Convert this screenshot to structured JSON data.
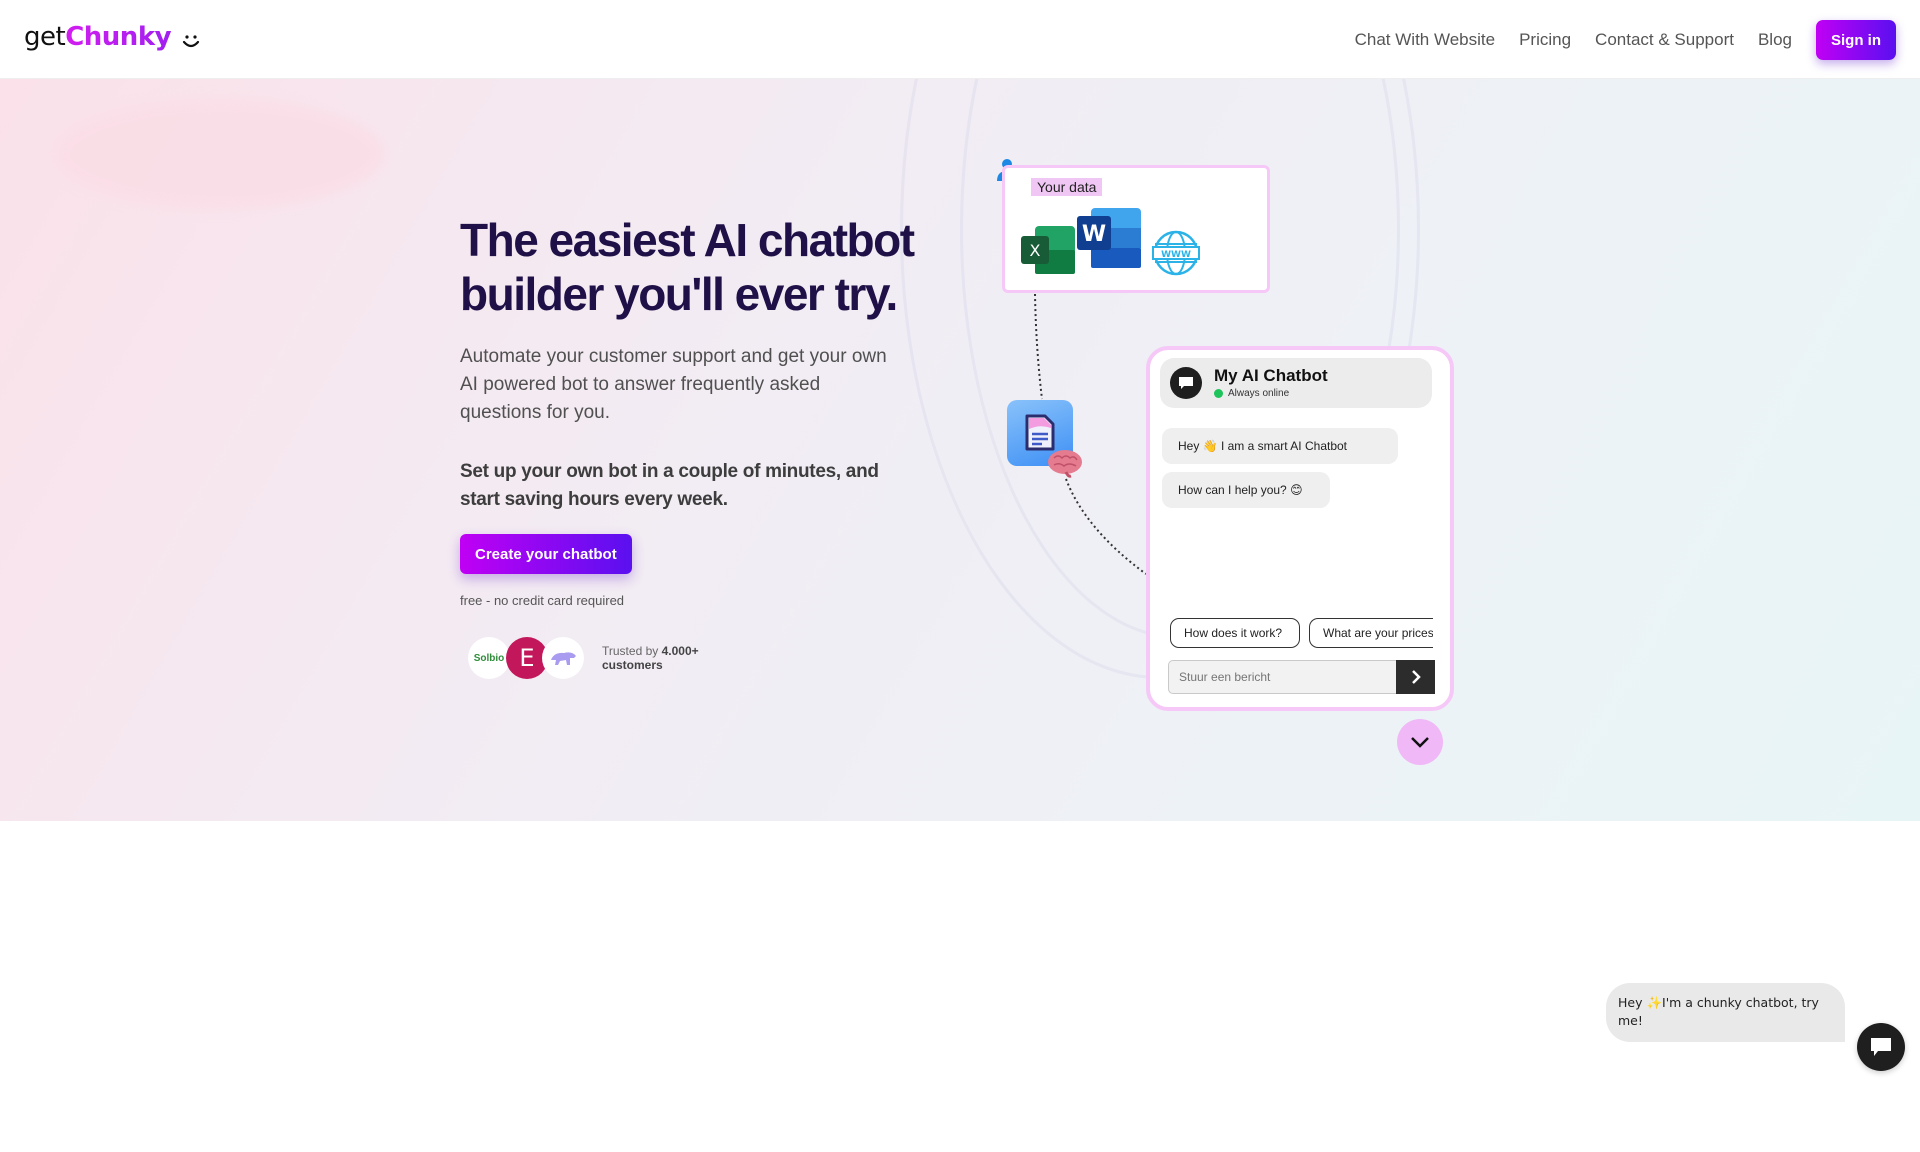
{
  "brand": {
    "prefix": "get",
    "name": "Chunky",
    "accent_color": "#c21ef2",
    "cta_gradient": [
      "#c000f4",
      "#5a10f0"
    ]
  },
  "nav": {
    "links": [
      {
        "label": "Chat With Website"
      },
      {
        "label": "Pricing"
      },
      {
        "label": "Contact & Support"
      },
      {
        "label": "Blog"
      }
    ],
    "signin_label": "Sign in"
  },
  "hero": {
    "title": "The easiest AI chatbot builder you'll ever try.",
    "lead": "Automate your customer support and get your own AI powered bot to answer frequently asked questions for you.",
    "lead_bold": "Set up your own bot in a couple of minutes, and start saving hours every week.",
    "cta_label": "Create your chatbot",
    "cta_note": "free - no credit card required",
    "trusted": {
      "prefix": "Trusted by",
      "count": "4.000+",
      "suffix": "customers",
      "logos": [
        {
          "name": "Solbio",
          "label": "Solbio"
        },
        {
          "name": "E",
          "label": "E"
        },
        {
          "name": "bear-logo",
          "label": ""
        }
      ]
    }
  },
  "illustration": {
    "data_label": "Your data",
    "sources": [
      "excel-icon",
      "word-icon",
      "globe-www-icon"
    ],
    "chat": {
      "title": "My AI Chatbot",
      "status": "Always online",
      "status_color": "#1fc35b",
      "messages": [
        {
          "text": "Hey 👋 I am a smart AI Chatbot"
        },
        {
          "text": "How can I help you? 😊"
        }
      ],
      "suggestions": [
        {
          "label": "How does it work?"
        },
        {
          "label": "What are your prices?"
        }
      ],
      "input_placeholder": "Stuur een bericht"
    }
  },
  "widget": {
    "greeting": "Hey ✨I'm a chunky chatbot, try me!"
  }
}
